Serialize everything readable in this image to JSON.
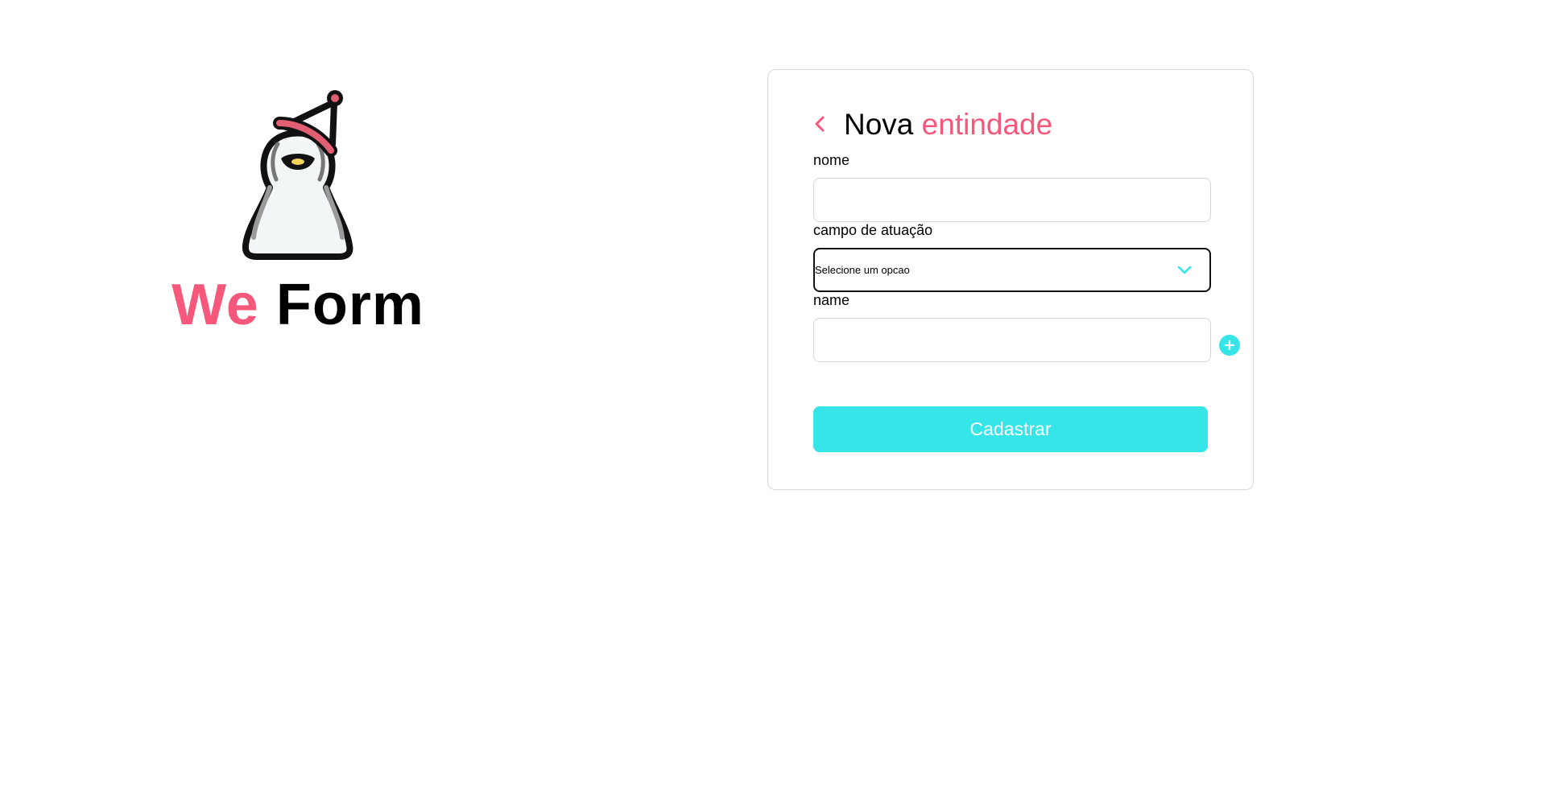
{
  "brand": {
    "mascot_icon": "penguin-party-hat-icon",
    "title_part1": "We",
    "title_part2": "Form",
    "accent_color": "#f5587b"
  },
  "form": {
    "back_icon": "chevron-left-icon",
    "title_part1": "Nova",
    "title_part2": "entindade",
    "fields": [
      {
        "label": "nome",
        "value": "",
        "placeholder": ""
      },
      {
        "label": "campo de atuação",
        "selected": "Selecione um opcao",
        "icon": "chevron-down-icon"
      },
      {
        "label": "name",
        "value": "",
        "placeholder": ""
      }
    ],
    "add_icon": "plus-circle-icon",
    "submit_label": "Cadastrar",
    "button_color": "#36e5e8"
  }
}
